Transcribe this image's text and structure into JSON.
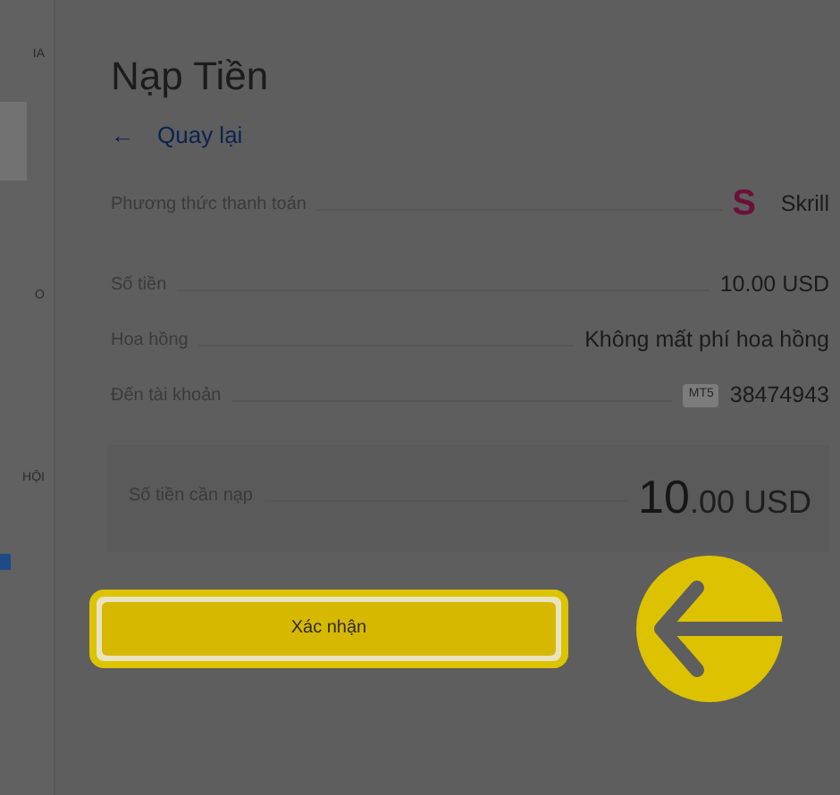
{
  "sidebar": {
    "items": [
      {
        "label": "IA"
      },
      {
        "label": "O"
      },
      {
        "label": "HỘI"
      }
    ]
  },
  "title": "Nạp Tiền",
  "back_link": {
    "icon": "←",
    "label": "Quay lại"
  },
  "method": {
    "label": "Phương thức thanh toán",
    "logo": "S",
    "value": "Skrill"
  },
  "details": [
    {
      "label": "Số tiền",
      "value": "10.00 USD"
    },
    {
      "label": "Hoa hồng",
      "value": "Không mất phí hoa hồng"
    },
    {
      "label": "Đến tài khoản",
      "tag": "MT5",
      "value": "38474943"
    }
  ],
  "total": {
    "label": "Số tiền cần nạp",
    "whole": "10",
    "fraction": ".00 USD"
  },
  "confirm_button": {
    "label": "Xác nhận"
  }
}
